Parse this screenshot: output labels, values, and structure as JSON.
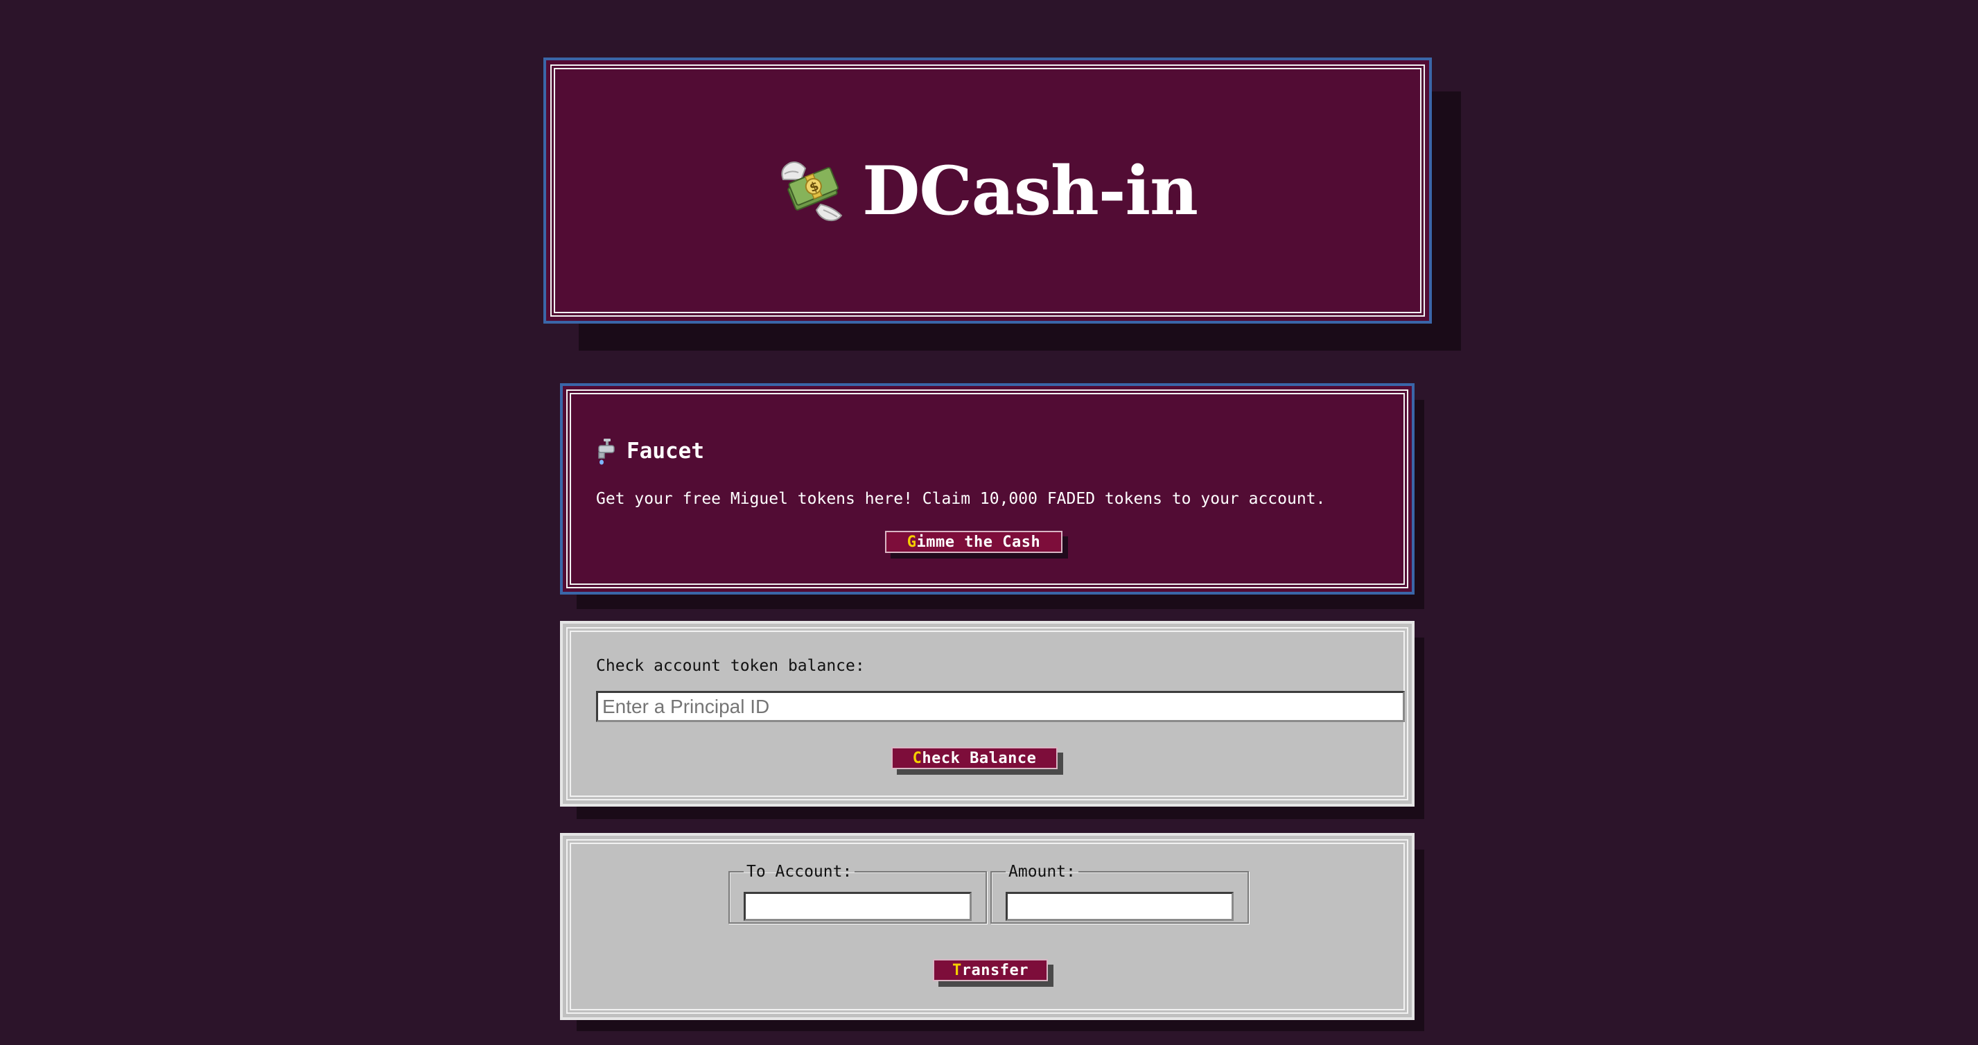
{
  "app": {
    "title": "DCash-in",
    "logo_icon": "money-with-wings-icon"
  },
  "faucet": {
    "icon": "faucet-icon",
    "heading": "Faucet",
    "description": "Get your free Miguel tokens here! Claim 10,000 FADED tokens to your account.",
    "button": {
      "hotkey": "G",
      "rest": "imme the Cash"
    }
  },
  "balance": {
    "label": "Check account token balance:",
    "input_placeholder": "Enter a Principal ID",
    "input_value": "",
    "button": {
      "hotkey": "C",
      "rest": "heck Balance"
    }
  },
  "transfer": {
    "to_account_legend": "To Account:",
    "to_account_value": "",
    "amount_legend": "Amount:",
    "amount_value": "",
    "button": {
      "hotkey": "T",
      "rest": "ransfer"
    }
  },
  "colors": {
    "background": "#2c142a",
    "panel_maroon": "#520c34",
    "panel_grey": "#c0c0c0",
    "button": "#7d0d3a",
    "hotkey": "#f5d000",
    "panel_border_blue": "#3a66a8"
  }
}
